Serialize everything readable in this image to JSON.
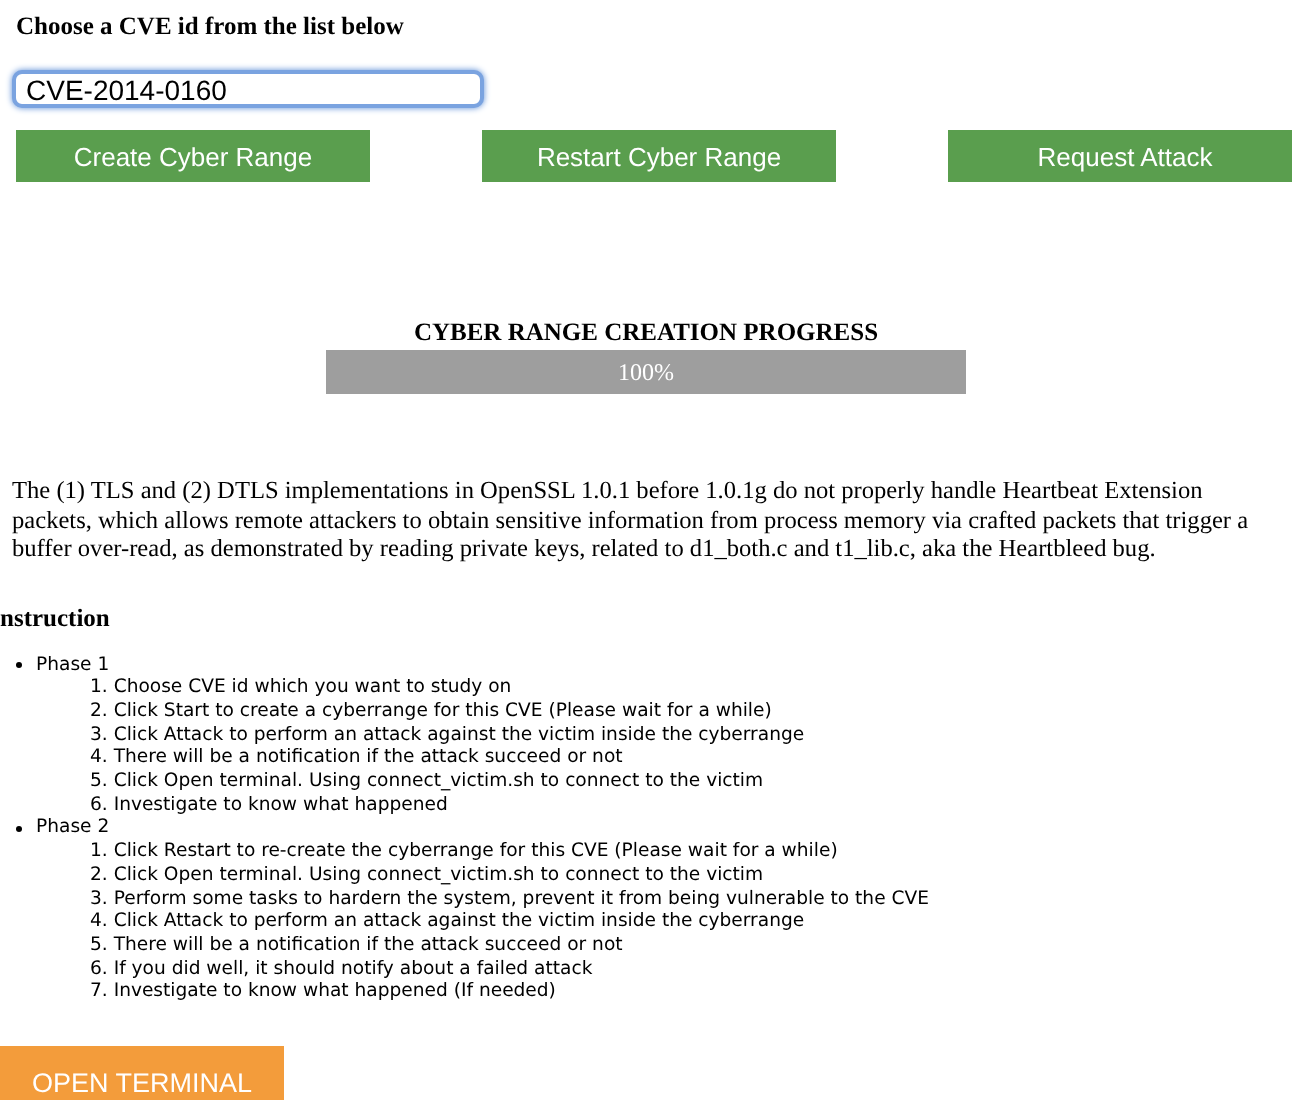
{
  "heading": "Choose a CVE id from the list below",
  "cve_field": {
    "value": "CVE-2014-0160"
  },
  "buttons": [
    "Create Cyber Range",
    "Restart Cyber Range",
    "Request Attack"
  ],
  "progress": {
    "title": "CYBER RANGE CREATION PROGRESS",
    "level": 1,
    "reading": "100%"
  },
  "description": "The (1) TLS and (2) DTLS implementations in OpenSSL 1.0.1 before 1.0.1g do not properly handle Heartbeat Extension packets, which allows remote attackers to obtain sensitive information from process memory via crafted packets that trigger a buffer over-read, as demonstrated by reading private keys, related to d1_both.c and t1_lib.c, aka the Heartbleed bug.",
  "instruction": {
    "title": "nstruction",
    "phases": [
      {
        "label": "Phase 1",
        "steps": [
          "1. Choose CVE id which you want to study on",
          "2. Click Start to create a cyberrange for this CVE (Please wait for a while)",
          "3. Click Attack to perform an attack against the victim inside the cyberrange",
          "4. There will be a notification if the attack succeed or not",
          "5. Click Open terminal. Using connect_victim.sh to connect to the victim",
          "6. Investigate to know what happened"
        ]
      },
      {
        "label": "Phase 2",
        "steps": [
          "1. Click Restart to re-create the cyberrange for this CVE (Please wait for a while)",
          "2. Click Open terminal. Using connect_victim.sh to connect to the victim",
          "3. Perform some tasks to hardern the system, prevent it from being vulnerable to the CVE",
          "4. Click Attack to perform an attack against the victim inside the cyberrange",
          "5. There will be a notification if the attack succeed or not",
          "6. If you did well, it should notify about a failed attack",
          "7. Investigate to know what happened (If needed)"
        ]
      }
    ]
  },
  "terminal_button": "OPEN TERMINAL"
}
